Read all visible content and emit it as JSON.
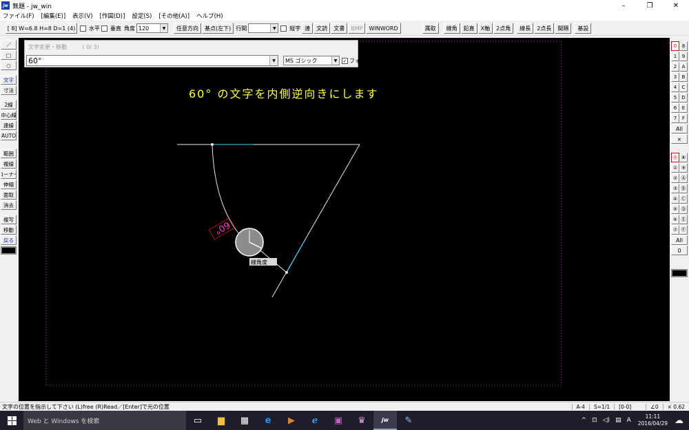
{
  "window": {
    "title": "無題 - jw_win",
    "app_icon": "jw",
    "controls": [
      "–",
      "❐",
      "✕"
    ]
  },
  "menu": [
    "ファイル(F)",
    "[編集(E)]",
    "表示(V)",
    "[作図(D)]",
    "設定(S)",
    "[その他(A)]",
    "ヘルプ(H)"
  ],
  "toolbar": {
    "layer_info": "[ 8]  W=6.8  H=8  D=1 (4)",
    "horizontal_label": "水平",
    "vertical_label": "垂直",
    "angle_label": "角度",
    "angle_value": "120",
    "arbitrary_dir": "任意方向",
    "base_point": "基点(左下)",
    "line_spacing_label": "行間",
    "line_spacing_value": "",
    "vertical_text_label": "縦字",
    "continuous": "連",
    "text_read": "文読",
    "text_write": "文書",
    "bmp": "BMP",
    "winword": "WINWORD",
    "right_buttons": [
      "属取",
      "線角",
      "鉛直",
      "X軸",
      "2点角",
      "線長",
      "2点長",
      "間隔",
      "基設"
    ]
  },
  "left_palette": {
    "group1": [
      "／",
      "□",
      "○"
    ],
    "group2": [
      "文字",
      "寸法",
      "2線",
      "中心線",
      "連線",
      "AUTO"
    ],
    "group3": [
      "範囲",
      "複線",
      "コーナー",
      "伸縮",
      "面取",
      "消去",
      "複写",
      "移動",
      "戻る"
    ]
  },
  "right_palette": {
    "set1": [
      [
        "0",
        "8"
      ],
      [
        "1",
        "9"
      ],
      [
        "2",
        "A"
      ],
      [
        "3",
        "B"
      ],
      [
        "4",
        "C"
      ],
      [
        "5",
        "D"
      ],
      [
        "6",
        "E"
      ],
      [
        "7",
        "F"
      ]
    ],
    "set1_all": "All",
    "set1_x": "×",
    "set2": [
      [
        "⓪",
        "⑧"
      ],
      [
        "①",
        "⑨"
      ],
      [
        "②",
        "Ⓐ"
      ],
      [
        "③",
        "Ⓑ"
      ],
      [
        "④",
        "Ⓒ"
      ],
      [
        "⑤",
        "Ⓓ"
      ],
      [
        "⑥",
        "Ⓔ"
      ],
      [
        "⑦",
        "Ⓕ"
      ]
    ],
    "set2_all": "All",
    "set2_zero": "0"
  },
  "text_dialog": {
    "label": "文字変更・移動",
    "count": "( 0/ 3)",
    "text_value": "60°",
    "font_value": "MS ゴシック",
    "font_read_label": "フォント読取",
    "font_read_checked": "✓"
  },
  "drawing": {
    "caption": "60° の文字を内側逆向きにします",
    "caption_color": "#ffff40",
    "angle_text": "60°",
    "angle_text_color": "#ff40c0",
    "tooltip": "線角度"
  },
  "status": {
    "message": "文字の位置を指示して下さい (L)free (R)Read／[Enter]で元の位置",
    "paper": "A-4",
    "scale": "S=1/1",
    "layer": "[0-0]",
    "angle": "∠0",
    "zoom": "× 0.62"
  },
  "taskbar": {
    "search_placeholder": "Web と Windows を検索",
    "time": "11:11",
    "date": "2016/04/29",
    "ime": "A"
  }
}
